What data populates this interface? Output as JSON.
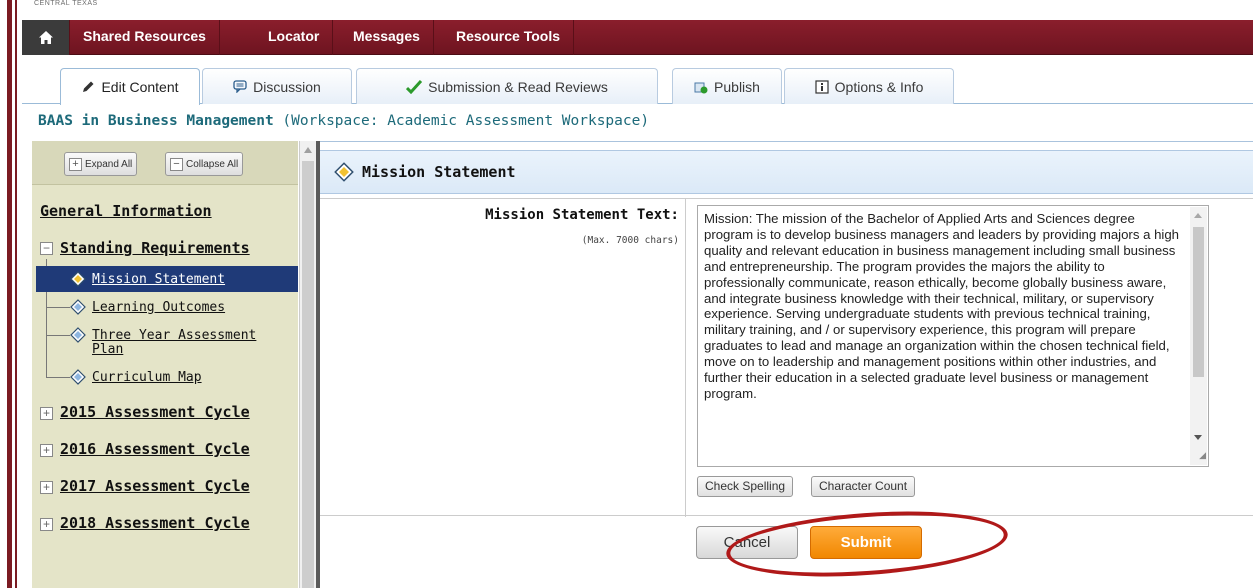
{
  "brand": {
    "text": "CENTRAL TEXAS"
  },
  "topnav": {
    "items": [
      "Shared Resources",
      "Locator",
      "Messages",
      "Resource Tools"
    ]
  },
  "tabs": [
    {
      "label": "Edit Content",
      "icon": "pencil-icon"
    },
    {
      "label": "Discussion",
      "icon": "chat-icon"
    },
    {
      "label": "Submission & Read Reviews",
      "icon": "checkmark-icon"
    },
    {
      "label": "Publish",
      "icon": "publish-icon"
    },
    {
      "label": "Options & Info",
      "icon": "info-icon"
    }
  ],
  "workspace": {
    "name": "BAAS in Business Management",
    "suffix": " (Workspace: Academic Assessment Workspace)"
  },
  "sidebar": {
    "expand_all": "Expand All",
    "collapse_all": "Collapse All",
    "general_information": "General Information",
    "standing_requirements": "Standing Requirements",
    "leaves": [
      "Mission Statement",
      "Learning Outcomes",
      "Three Year Assessment",
      "Plan",
      "Curriculum Map"
    ],
    "cycles": [
      "2015 Assessment Cycle",
      "2016 Assessment Cycle",
      "2017 Assessment Cycle",
      "2018 Assessment Cycle"
    ]
  },
  "main": {
    "section_title": "Mission Statement",
    "field_label": "Mission Statement Text:",
    "field_hint": "(Max. 7000 chars)",
    "mission_text": "Mission: The mission of the Bachelor of Applied Arts and Sciences degree program is to develop business managers and leaders by providing majors a high quality and relevant education in business management including small business and entrepreneurship. The program provides the majors the ability to professionally communicate, reason ethically, become globally business aware, and integrate business knowledge with their technical, military, or supervisory experience. Serving undergraduate students with previous technical training, military training, and / or supervisory experience, this program will prepare graduates to lead and manage an organization within the chosen technical field, move on to leadership and management positions within other industries, and further their education in a selected graduate level business or management program.",
    "check_spelling": "Check Spelling",
    "character_count": "Character Count",
    "cancel": "Cancel",
    "submit": "Submit"
  },
  "colors": {
    "nav": "#7b1b22",
    "submit": "#f59a23",
    "selected_row": "#1f3a78",
    "annotation": "#b01919"
  }
}
